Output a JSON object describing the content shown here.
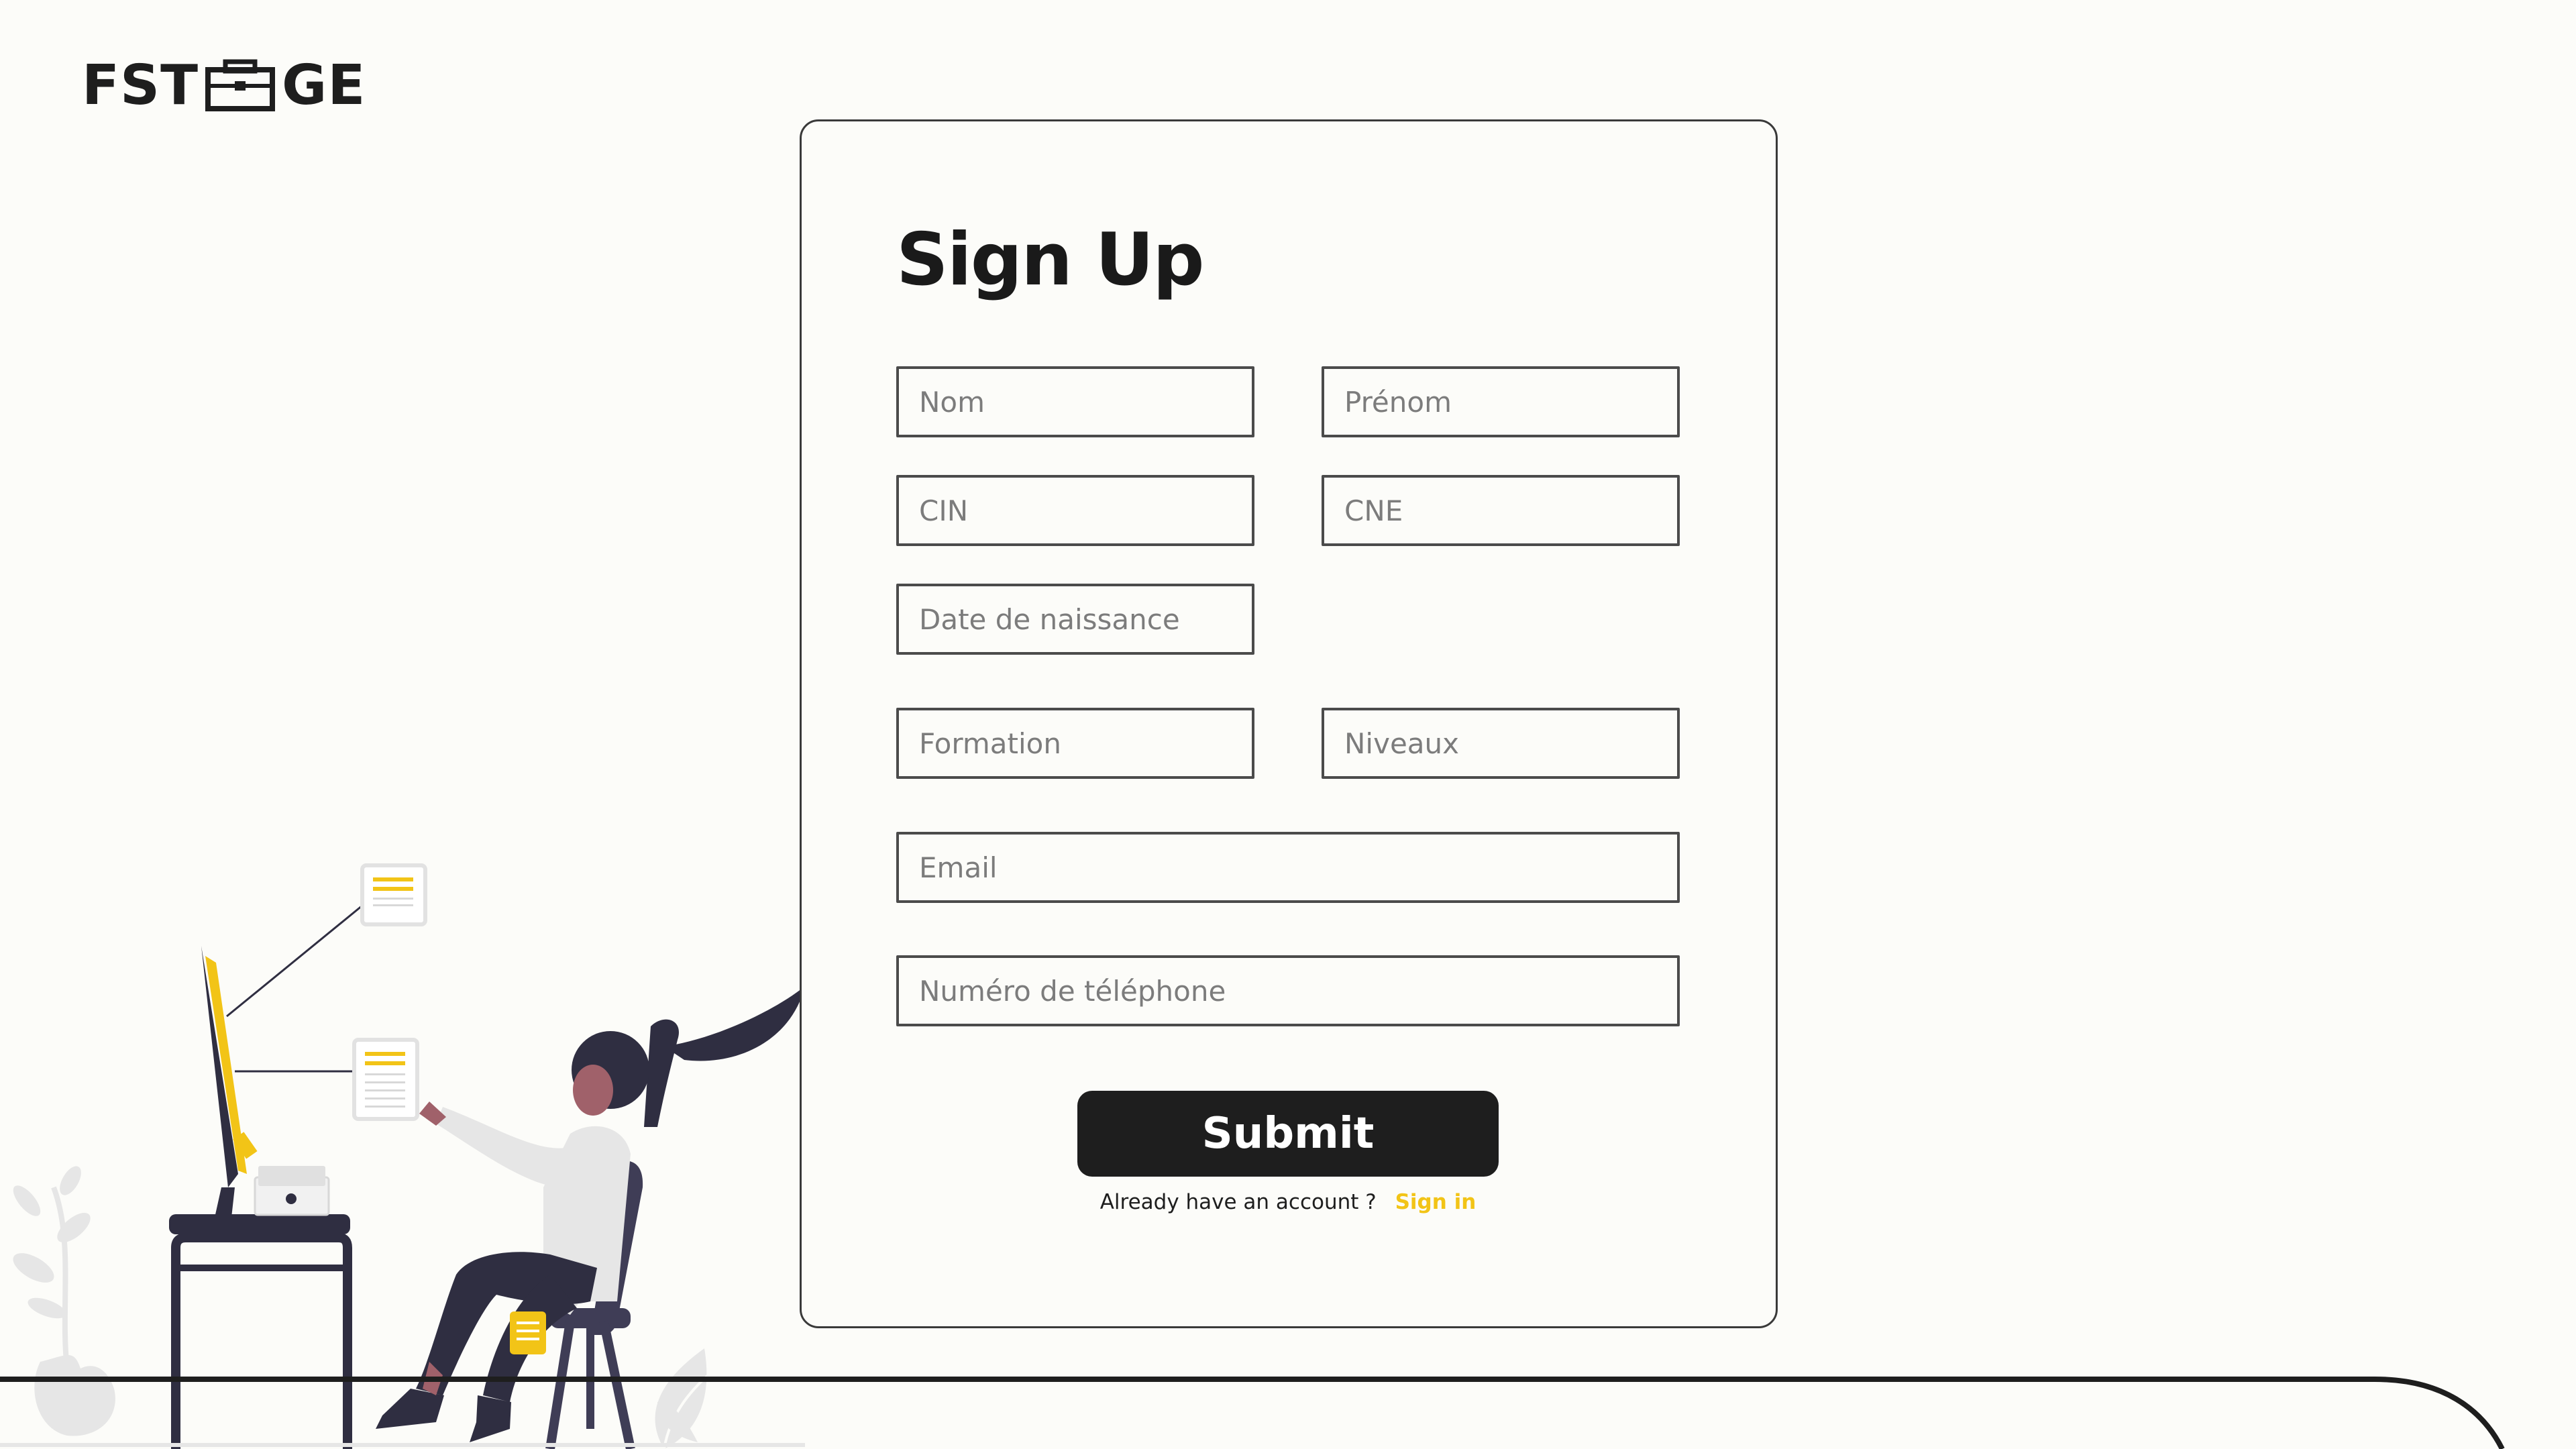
{
  "brand": {
    "left": "FST",
    "right": "GE"
  },
  "form": {
    "title": "Sign Up",
    "nom_placeholder": "Nom",
    "prenom_placeholder": "Prénom",
    "cin_placeholder": "CIN",
    "cne_placeholder": "CNE",
    "date_placeholder": "Date de naissance",
    "formation_placeholder": "Formation",
    "niveaux_placeholder": "Niveaux",
    "email_placeholder": "Email",
    "telephone_placeholder": "Numéro de téléphone",
    "submit_label": "Submit",
    "account_prompt": "Already have an account ?",
    "signin_label": "Sign in"
  },
  "colors": {
    "accent": "#f2c417",
    "dark": "#1e1e1e",
    "figure": "#2f2e41",
    "background": "#fcfcf9"
  }
}
